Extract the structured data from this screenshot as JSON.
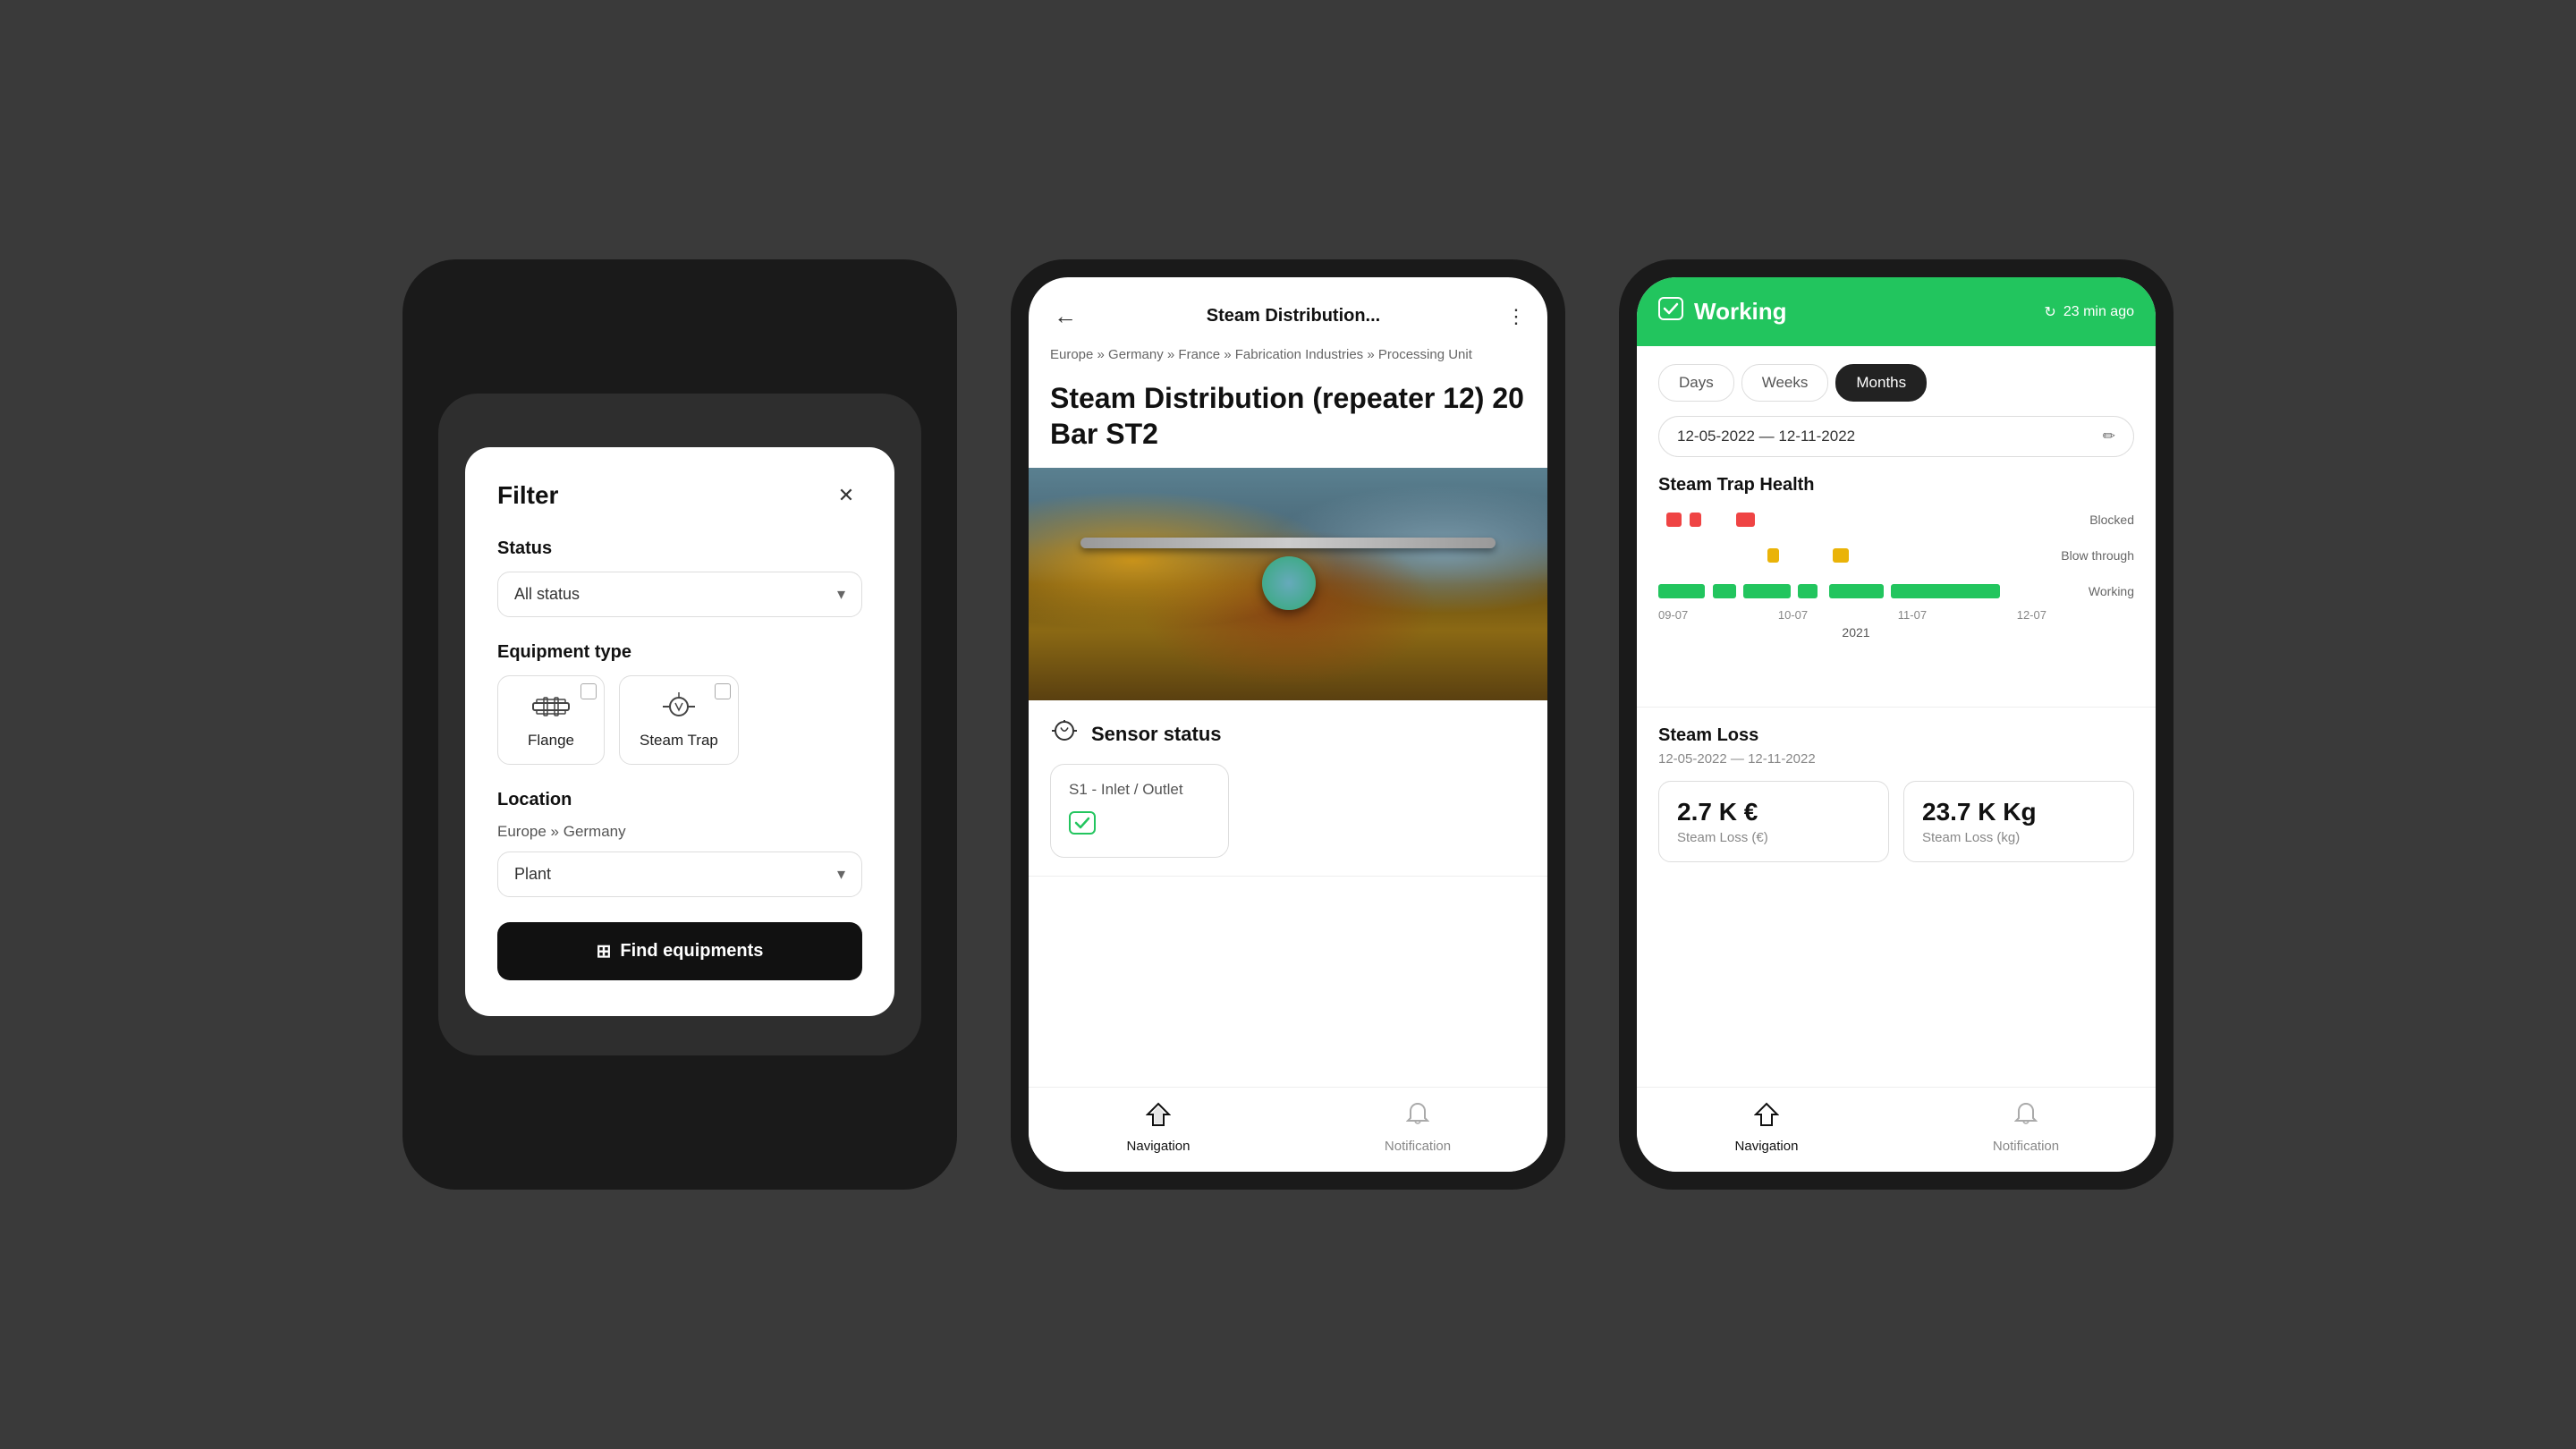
{
  "phone1": {
    "filter": {
      "title": "Filter",
      "status": {
        "label": "Status",
        "value": "All status"
      },
      "equipmentType": {
        "label": "Equipment type",
        "items": [
          {
            "id": "flange",
            "label": "Flange"
          },
          {
            "id": "steamtrap",
            "label": "Steam Trap"
          }
        ]
      },
      "location": {
        "label": "Location",
        "breadcrumb": "Europe » Germany",
        "plant": "Plant"
      },
      "findButton": "Find equipments"
    }
  },
  "phone2": {
    "header": {
      "title": "Steam Distribution..."
    },
    "breadcrumb": "Europe » Germany » France » Fabrication Industries » Processing Unit",
    "equipmentTitle": "Steam Distribution (repeater 12) 20 Bar ST2",
    "sensor": {
      "sectionTitle": "Sensor status",
      "card": {
        "title": "S1 - Inlet / Outlet"
      }
    },
    "nav": {
      "navigation": "Navigation",
      "notification": "Notification"
    }
  },
  "phone3": {
    "header": {
      "status": "Working",
      "refreshTime": "23 min ago"
    },
    "tabs": [
      {
        "label": "Days",
        "active": false
      },
      {
        "label": "Weeks",
        "active": false
      },
      {
        "label": "Months",
        "active": true
      }
    ],
    "dateRange": "12-05-2022 — 12-11-2022",
    "health": {
      "title": "Steam Trap Health",
      "legend": {
        "blocked": "Blocked",
        "blowThrough": "Blow through",
        "working": "Working"
      },
      "xLabels": [
        "09-07",
        "10-07",
        "11-07",
        "12-07"
      ],
      "year": "2021"
    },
    "steamLoss": {
      "title": "Steam Loss",
      "dateRange": "12-05-2022 — 12-11-2022",
      "cards": [
        {
          "value": "2.7 K €",
          "label": "Steam Loss (€)"
        },
        {
          "value": "23.7 K Kg",
          "label": "Steam Loss (kg)"
        }
      ]
    },
    "nav": {
      "navigation": "Navigation",
      "notification": "Notification"
    }
  }
}
